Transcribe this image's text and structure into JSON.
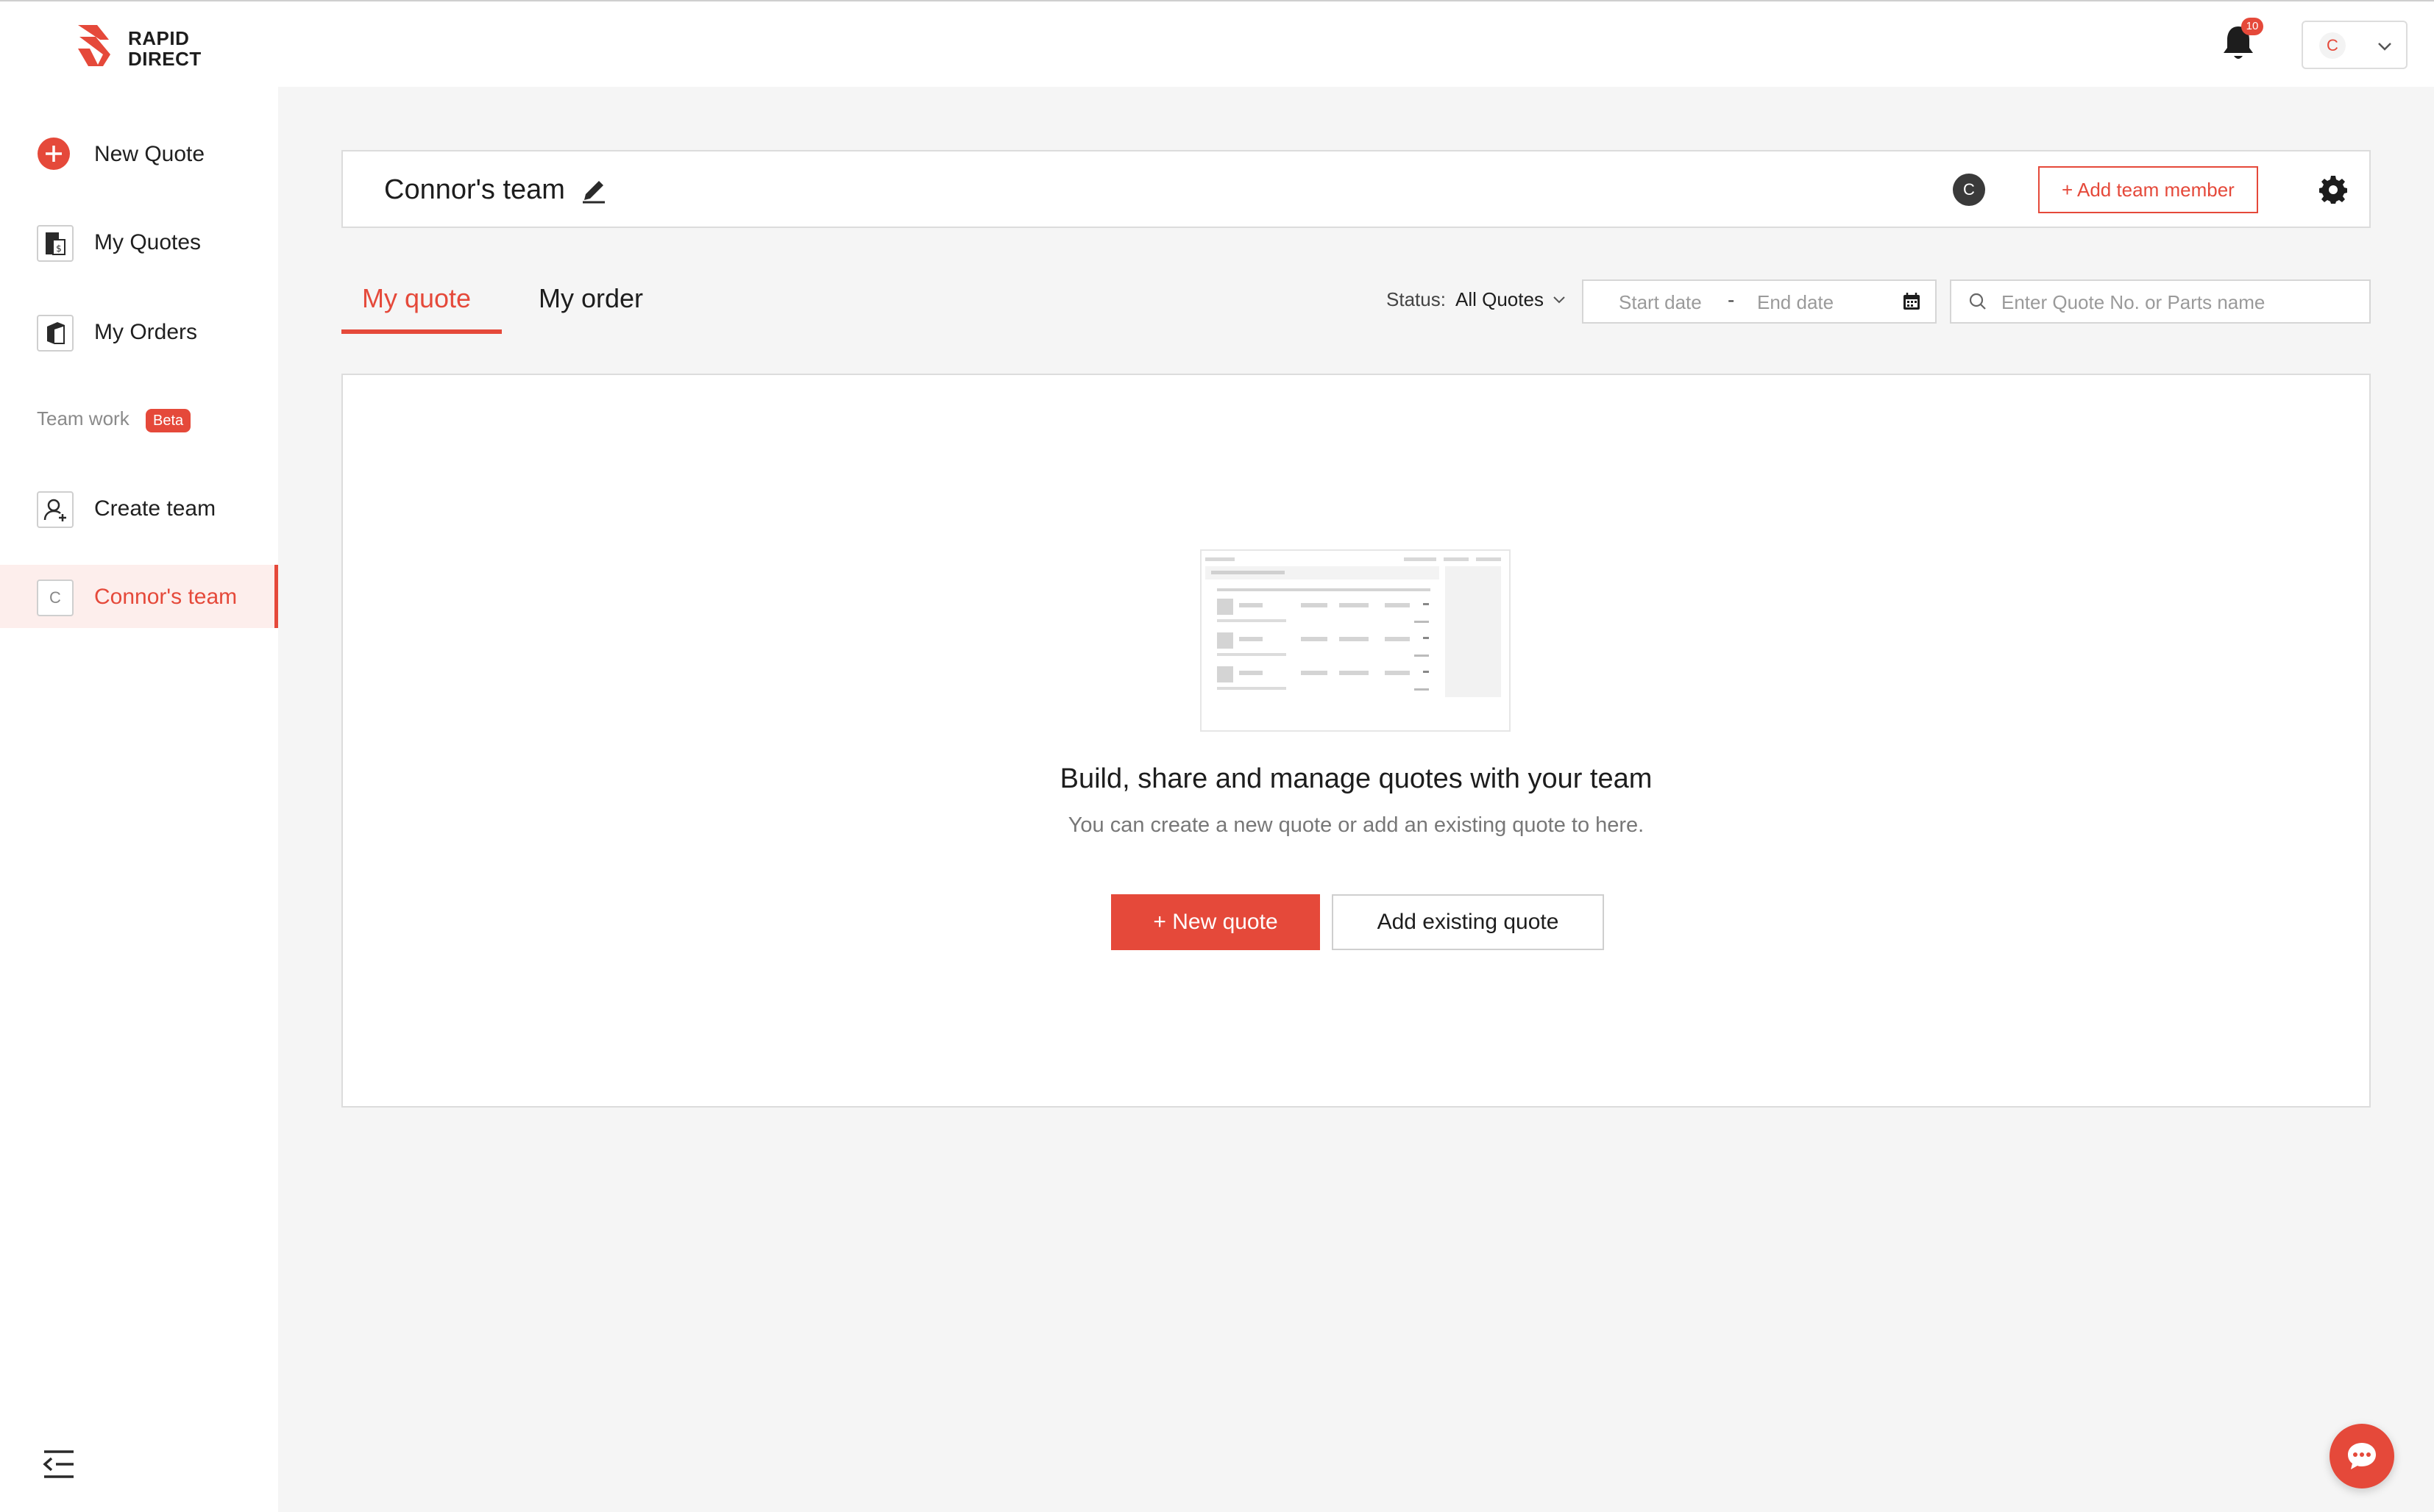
{
  "brand": {
    "logo_text_line1": "RAPID",
    "logo_text_line2": "DIRECT",
    "accent_color": "#e5493a"
  },
  "header": {
    "notification_count": "10",
    "user_initial": "C"
  },
  "sidebar": {
    "items": [
      {
        "label": "New Quote",
        "icon": "plus-circle-icon"
      },
      {
        "label": "My Quotes",
        "icon": "quote-document-icon"
      },
      {
        "label": "My Orders",
        "icon": "order-box-icon"
      }
    ],
    "section_label": "Team work",
    "section_badge": "Beta",
    "team_items": [
      {
        "label": "Create team",
        "icon": "add-user-icon"
      },
      {
        "label": "Connor's team",
        "icon_letter": "C",
        "active": true
      }
    ]
  },
  "team_bar": {
    "team_name": "Connor's team",
    "member_initial": "C",
    "add_member_label": "+ Add team member"
  },
  "tabs": [
    {
      "label": "My quote",
      "active": true
    },
    {
      "label": "My order",
      "active": false
    }
  ],
  "filters": {
    "status_label": "Status:",
    "status_value": "All Quotes",
    "start_date_placeholder": "Start date",
    "date_separator": "-",
    "end_date_placeholder": "End date",
    "search_placeholder": "Enter Quote No. or Parts name"
  },
  "empty_state": {
    "title": "Build, share and manage quotes with your team",
    "subtitle": "You can create a new quote or add an existing quote to here.",
    "primary_button": "+ New quote",
    "secondary_button": "Add existing quote"
  }
}
